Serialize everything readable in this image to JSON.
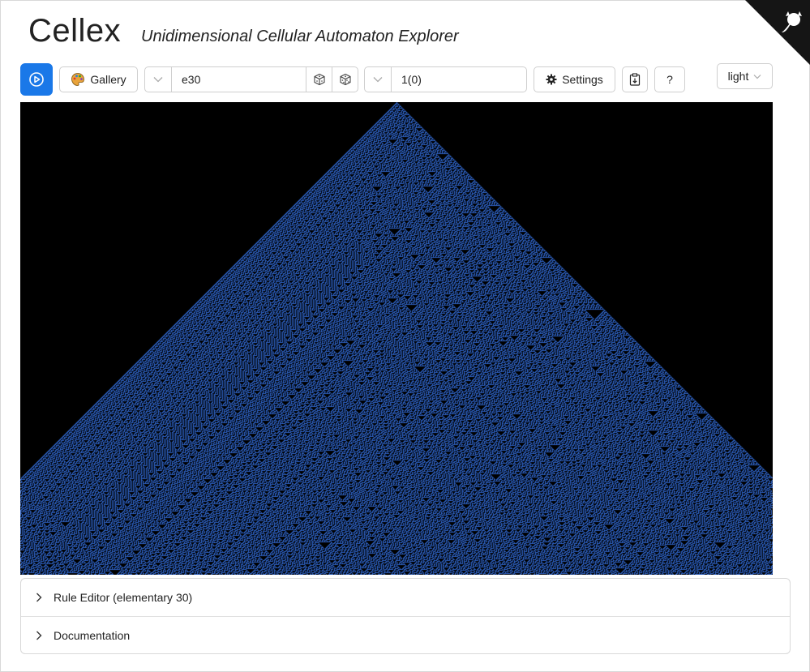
{
  "header": {
    "title": "Cellex",
    "subtitle": "Unidimensional Cellular Automaton Explorer"
  },
  "toolbar": {
    "gallery_label": "Gallery",
    "rule_value": "e30",
    "init_value": "1(0)",
    "settings_label": "Settings",
    "help_label": "?",
    "theme_value": "light"
  },
  "automaton": {
    "rule": 30,
    "live_color": "#2f64c8",
    "dead_color": "#000000"
  },
  "panels": {
    "rule_editor": "Rule Editor (elementary 30)",
    "documentation": "Documentation"
  },
  "colors": {
    "accent": "#1a78e8",
    "corner": "#111111"
  }
}
